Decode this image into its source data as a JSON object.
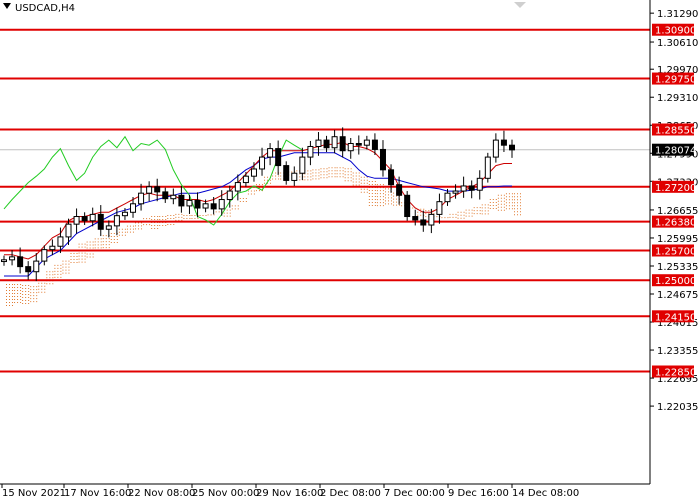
{
  "chart_title": "USDCAD,H4",
  "colors": {
    "background": "#ffffff",
    "candle": "#000000",
    "level_line": "#e00000",
    "level_label_bg": "#e00000",
    "level_label_text": "#ffffff",
    "current_price_bg": "#000000",
    "current_price_text": "#ffffff",
    "tenkan": "#cc0000",
    "kijun": "#0000cc",
    "chikou": "#22cc22",
    "cloud": "#e07a30"
  },
  "chart_data": {
    "type": "candlestick",
    "title": "USDCAD,H4",
    "ylim": [
      1.202,
      1.316
    ],
    "y_ticks": [
      "1.31290",
      "1.30610",
      "1.29970",
      "1.29310",
      "1.28650",
      "1.27990",
      "1.27330",
      "1.26655",
      "1.25995",
      "1.25335",
      "1.24675",
      "1.24015",
      "1.23355",
      "1.22695",
      "1.22035"
    ],
    "x_ticks": [
      "15 Nov 2021",
      "17 Nov 16:00",
      "22 Nov 08:00",
      "25 Nov 00:00",
      "29 Nov 16:00",
      "2 Dec 08:00",
      "7 Dec 00:00",
      "9 Dec 16:00",
      "14 Dec 08:00"
    ],
    "levels": [
      "1.30900",
      "1.29750",
      "1.28550",
      "1.27200",
      "1.26380",
      "1.25700",
      "1.25000",
      "1.24150",
      "1.22850"
    ],
    "current_price": "1.28074",
    "indicators": [
      "Ichimoku Tenkan-sen",
      "Ichimoku Kijun-sen",
      "Ichimoku Chikou Span",
      "Ichimoku Cloud"
    ],
    "close_path": [
      1.2548,
      1.2555,
      1.2532,
      1.252,
      1.2545,
      1.2572,
      1.258,
      1.2602,
      1.2632,
      1.265,
      1.264,
      1.2655,
      1.262,
      1.2628,
      1.2652,
      1.266,
      1.268,
      1.2705,
      1.272,
      1.2708,
      1.2692,
      1.27,
      1.2675,
      1.2688,
      1.267,
      1.268,
      1.2668,
      1.269,
      1.271,
      1.273,
      1.2745,
      1.2762,
      1.279,
      1.281,
      1.277,
      1.2735,
      1.2752,
      1.279,
      1.2815,
      1.283,
      1.2812,
      1.2838,
      1.2805,
      1.2822,
      1.2818,
      1.283,
      1.2808,
      1.276,
      1.2725,
      1.27,
      1.265,
      1.2642,
      1.263,
      1.2655,
      1.2685,
      1.2705,
      1.271,
      1.2722,
      1.2712,
      1.274,
      1.279,
      1.283,
      1.2818,
      1.2807
    ],
    "tenkan": [
      1.256,
      1.256,
      1.2555,
      1.255,
      1.256,
      1.258,
      1.26,
      1.261,
      1.264,
      1.265,
      1.265,
      1.2655,
      1.266,
      1.266,
      1.267,
      1.268,
      1.269,
      1.27,
      1.2705,
      1.27,
      1.27,
      1.27,
      1.269,
      1.269,
      1.269,
      1.2685,
      1.269,
      1.27,
      1.271,
      1.273,
      1.275,
      1.277,
      1.279,
      1.2805,
      1.2805,
      1.2805,
      1.2805,
      1.2805,
      1.281,
      1.2815,
      1.282,
      1.282,
      1.2825,
      1.2815,
      1.2815,
      1.281,
      1.28,
      1.278,
      1.276,
      1.272,
      1.269,
      1.267,
      1.266,
      1.266,
      1.267,
      1.269,
      1.27,
      1.271,
      1.272,
      1.273,
      1.275,
      1.277,
      1.2775,
      1.2775
    ],
    "kijun": [
      1.251,
      1.251,
      1.251,
      1.251,
      1.253,
      1.255,
      1.256,
      1.257,
      1.259,
      1.261,
      1.262,
      1.263,
      1.264,
      1.265,
      1.266,
      1.2665,
      1.267,
      1.268,
      1.2685,
      1.269,
      1.2695,
      1.27,
      1.2705,
      1.2705,
      1.2705,
      1.271,
      1.2715,
      1.272,
      1.273,
      1.2745,
      1.276,
      1.277,
      1.2785,
      1.279,
      1.279,
      1.2795,
      1.28,
      1.28,
      1.28,
      1.28,
      1.28,
      1.28,
      1.279,
      1.278,
      1.276,
      1.2745,
      1.274,
      1.274,
      1.274,
      1.2735,
      1.273,
      1.2725,
      1.272,
      1.2718,
      1.2715,
      1.271,
      1.271,
      1.271,
      1.2712,
      1.2715,
      1.272,
      1.272,
      1.2722,
      1.2722
    ]
  }
}
